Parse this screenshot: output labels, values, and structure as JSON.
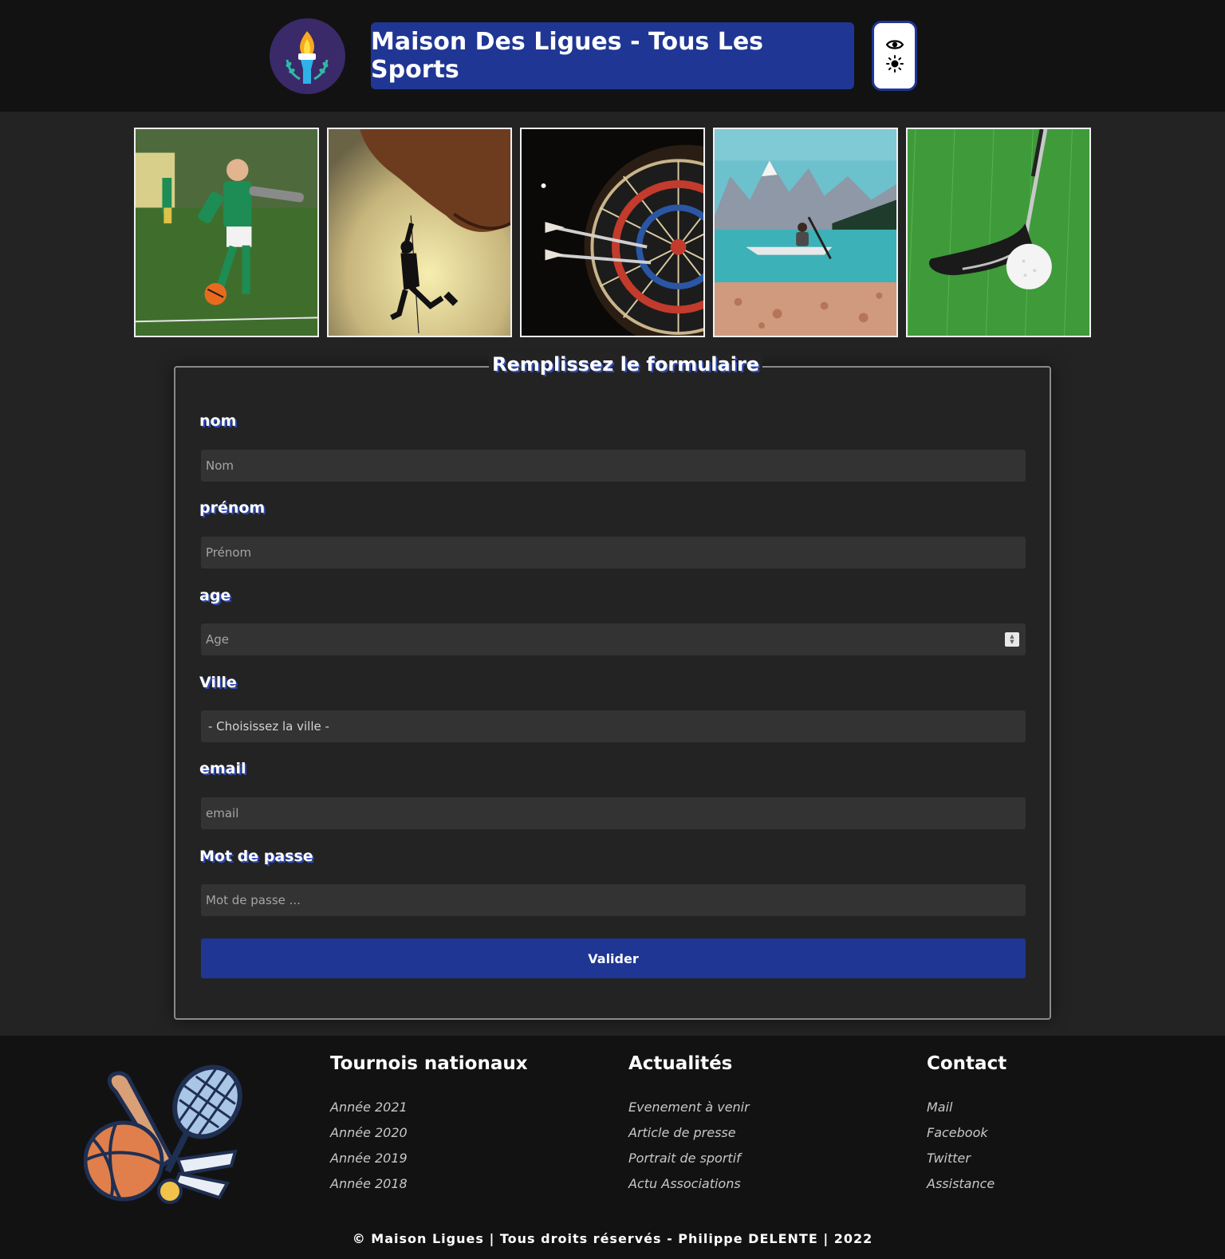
{
  "header": {
    "title": "Maison Des Ligues - Tous Les Sports",
    "logo_icon": "torch-icon",
    "toggle_icons": [
      "eye-icon",
      "sun-icon"
    ]
  },
  "gallery": {
    "photos": [
      "soccer-photo",
      "climbing-photo",
      "darts-photo",
      "kayak-photo",
      "golf-photo"
    ]
  },
  "form": {
    "legend": "Remplissez le formulaire",
    "fields": {
      "nom": {
        "label": "nom",
        "placeholder": "Nom"
      },
      "prenom": {
        "label": "prénom",
        "placeholder": "Prénom"
      },
      "age": {
        "label": "age",
        "placeholder": "Age"
      },
      "ville": {
        "label": "Ville",
        "selected": "- Choisissez la ville -"
      },
      "email": {
        "label": "email",
        "placeholder": "email"
      },
      "password": {
        "label": "Mot de passe",
        "placeholder": "Mot de passe ..."
      }
    },
    "submit_label": "Valider"
  },
  "footer": {
    "columns": [
      {
        "title": "Tournois nationaux",
        "items": [
          "Année 2021",
          "Année 2020",
          "Année 2019",
          "Année 2018"
        ]
      },
      {
        "title": "Actualités",
        "items": [
          "Evenement à venir",
          "Article de presse",
          "Portrait de sportif",
          "Actu Associations"
        ]
      },
      {
        "title": "Contact",
        "items": [
          "Mail",
          "Facebook",
          "Twitter",
          "Assistance"
        ]
      }
    ],
    "copyright": "© Maison Ligues | Tous droits réservés - Philippe DELENTE | 2022"
  },
  "colors": {
    "background": "#232323",
    "header_footer": "#121212",
    "accent": "#1f3694",
    "input_bg": "#333333"
  }
}
